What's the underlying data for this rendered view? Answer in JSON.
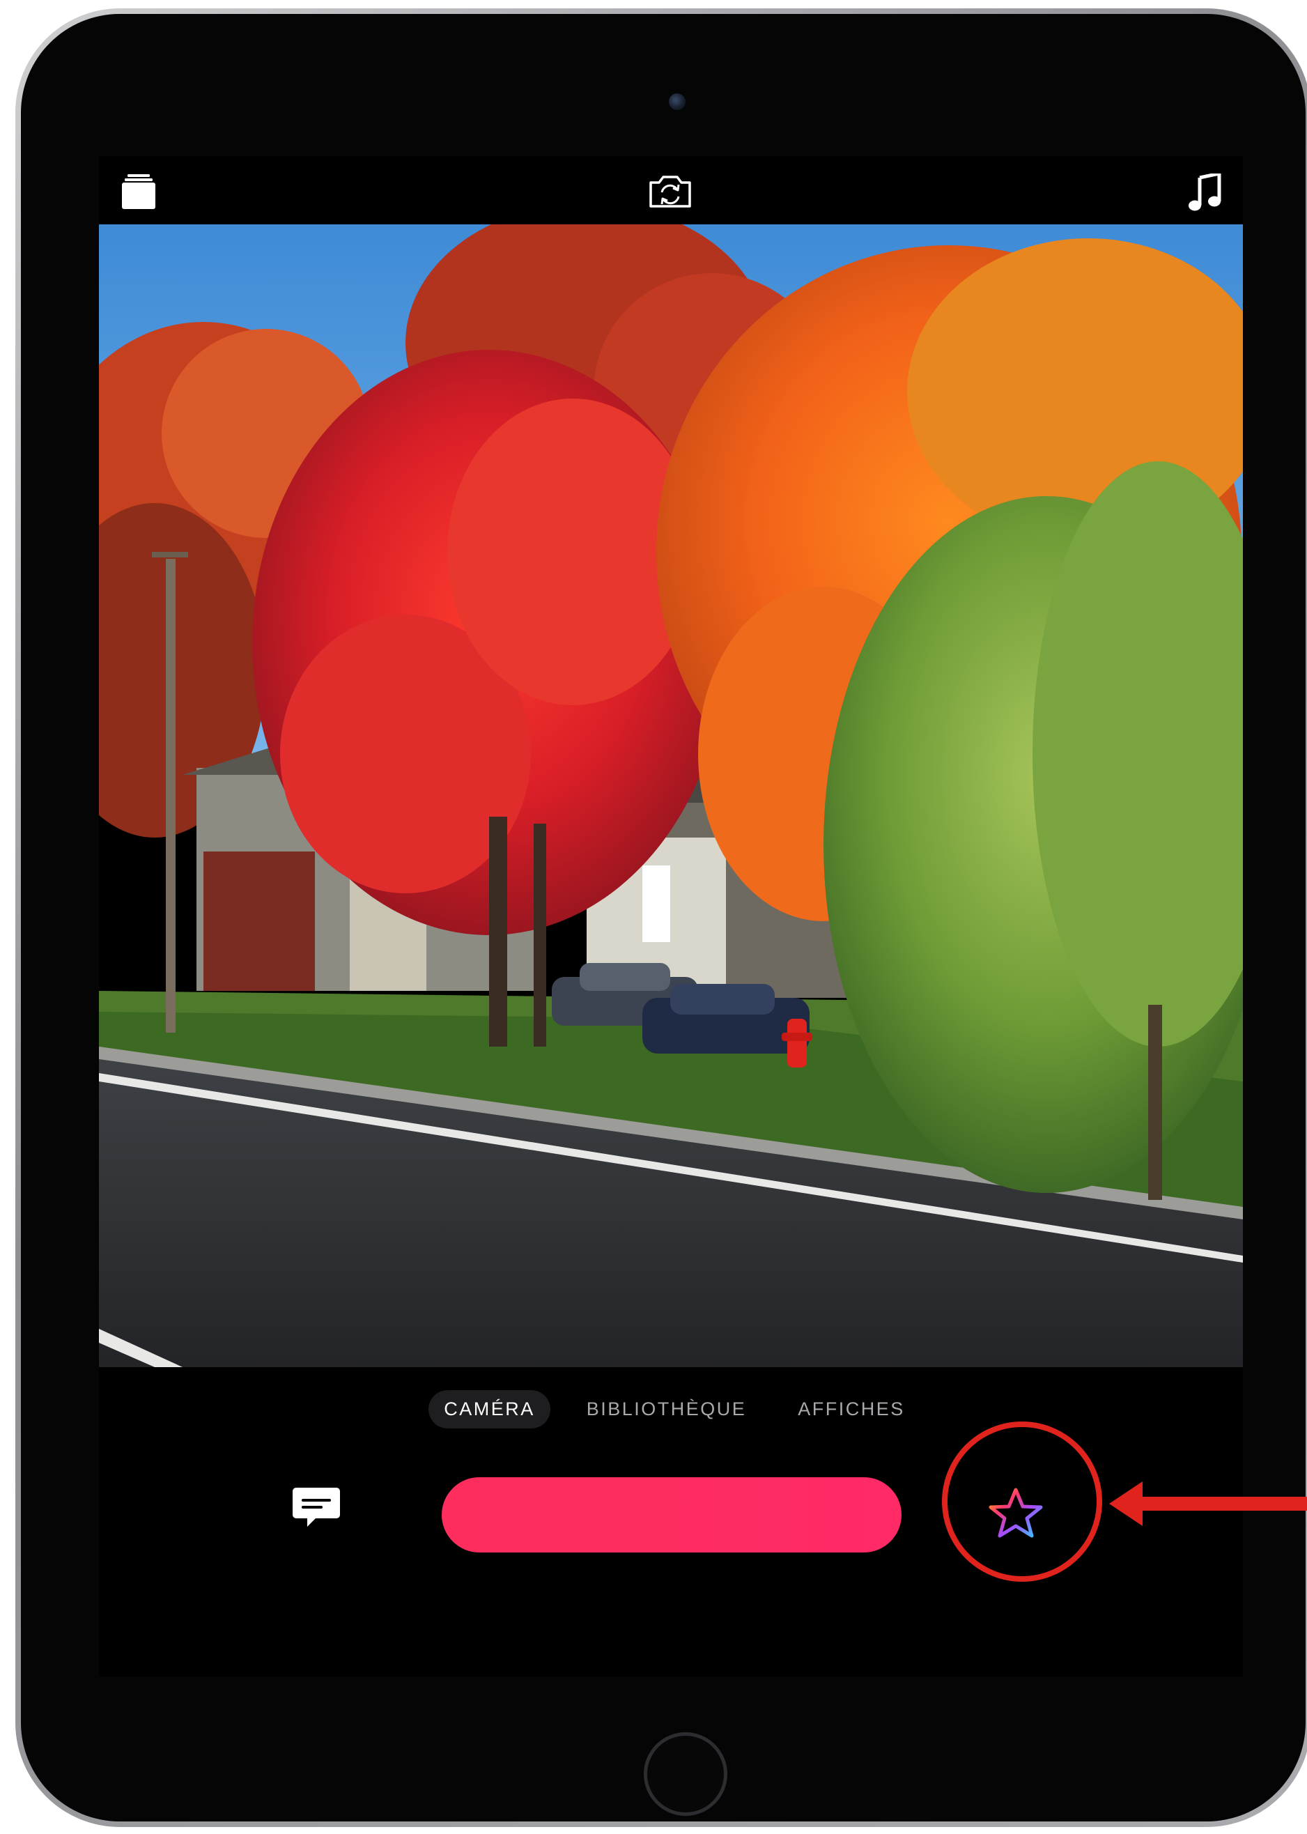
{
  "top_bar": {
    "library_icon": "library-stack-icon",
    "flip_camera_icon": "flip-camera-icon",
    "music_icon": "music-note-icon"
  },
  "mode_tabs": [
    {
      "label": "CAMÉRA",
      "active": true
    },
    {
      "label": "BIBLIOTHÈQUE",
      "active": false
    },
    {
      "label": "AFFICHES",
      "active": false
    }
  ],
  "controls": {
    "captions_icon": "speech-bubble-icon",
    "record_color": "#ff2d5e",
    "effects_icon": "rainbow-star-icon"
  },
  "annotation": {
    "color": "#e0231c",
    "target": "effects-button"
  }
}
